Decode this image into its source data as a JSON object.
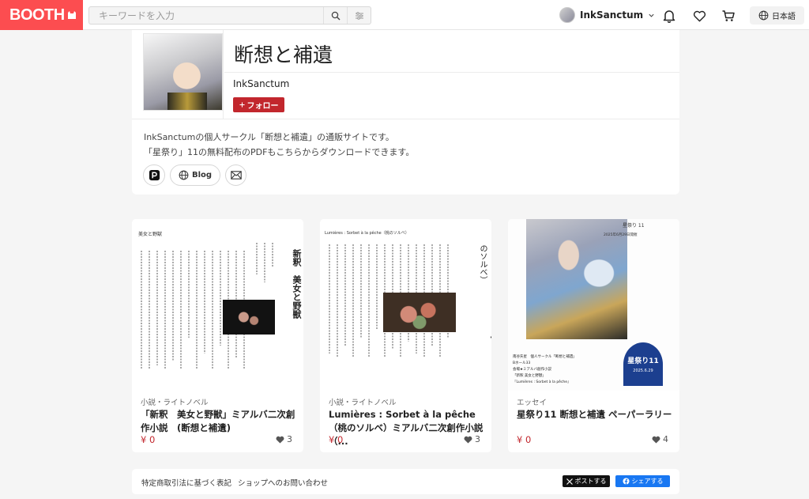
{
  "header": {
    "logo": "BOOTH",
    "search_placeholder": "キーワードを入力",
    "user_name": "InkSanctum",
    "language": "日本語"
  },
  "shop": {
    "title": "断想と補遺",
    "owner": "InkSanctum",
    "follow_label": "フォロー",
    "description_lines": [
      "InkSanctumの個人サークル「断想と補遺」の通販サイトです。",
      "「星祭り」11の無料配布のPDFもこちらからダウンロードできます。"
    ],
    "social": {
      "blog_label": "Blog"
    }
  },
  "products": [
    {
      "category": "小説・ライトノベル",
      "title": "「新釈　美女と野獣」ミアルバ二次創作小説　(断想と補遺)",
      "price": "¥ 0",
      "likes": "3",
      "thumb_heading": "美女と野獣",
      "thumb_vertical_title": "新釈　美女と野獣"
    },
    {
      "category": "小説・ライトノベル",
      "title": "Lumières : Sorbet à la pêche（桃のソルベ）ミアルバ二次創作小説（...",
      "price": "¥ 0",
      "likes": "3",
      "thumb_heading": "Lumières : Sorbet à la pêche（桃のソルベ）",
      "thumb_vertical_title": "Lumières : Sorbet à la pêche（桃のソルベ）"
    },
    {
      "category": "エッセイ",
      "title": "星祭り11 断想と補遺 ペーパーラリー",
      "price": "¥ 0",
      "likes": "4",
      "thumb_heading": "星祭り 11",
      "thumb_date": "2025年6月29日開催",
      "thumb_badge_title": "星祭り11",
      "thumb_badge_date": "2025.6.29",
      "thumb_circle": "南谷矢星　個人サークル「断想と補遺」",
      "thumb_hall": "Bホール33",
      "thumb_dist_label": "会場★ミアルバ創作小説",
      "thumb_work1": "「新釈 美女と野獣」",
      "thumb_work2": "『Lumières : Sorbet à la pêche』"
    }
  ],
  "footer": {
    "link1": "特定商取引法に基づく表記",
    "link2": "ショップへのお問い合わせ",
    "x_share": "ポストする",
    "fb_share": "シェアする"
  },
  "colors": {
    "brand": "#fc4d50",
    "accent": "#c2272d",
    "facebook": "#1877f2"
  }
}
